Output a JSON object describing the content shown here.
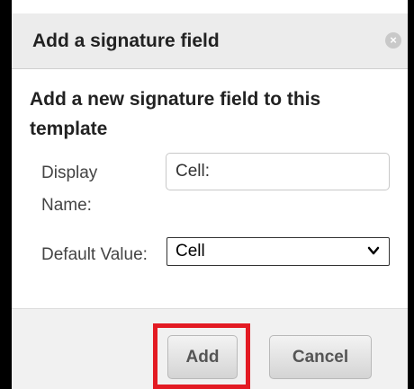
{
  "dialog": {
    "title": "Add a signature field",
    "close_symbol": "×",
    "heading": "Add a new signature field to this template"
  },
  "form": {
    "display_name": {
      "label": "Display Name:",
      "value": "Cell:"
    },
    "default_value": {
      "label": "Default Value:",
      "selected": "Cell"
    }
  },
  "buttons": {
    "add_label": "Add",
    "cancel_label": "Cancel"
  },
  "colors": {
    "highlight": "#e31b23",
    "titlebar_bg": "#ececec"
  },
  "icons": [
    "close-icon",
    "chevron-down-icon"
  ]
}
